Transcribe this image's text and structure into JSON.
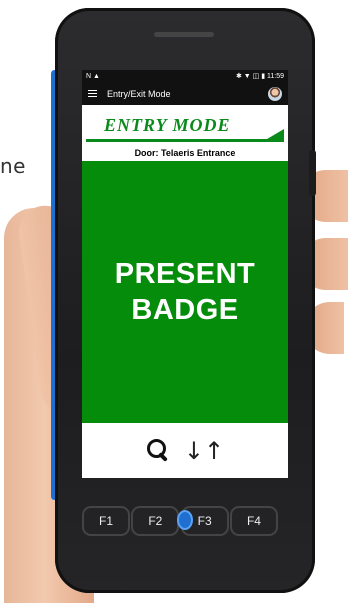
{
  "side_text": "ne",
  "status": {
    "left": "N ▲",
    "right": "✱ ▼ ◫ ▮ 11:59"
  },
  "appbar": {
    "title": "Entry/Exit Mode"
  },
  "banner": {
    "mode": "ENTRY MODE",
    "accent_color": "#0a8a1a"
  },
  "door": {
    "label": "Door: Telaeris Entrance"
  },
  "prompt": {
    "line1": "PRESENT",
    "line2": "BADGE",
    "background": "#058c0a"
  },
  "bottom": {
    "sort_glyph": "↓↑"
  },
  "function_keys": [
    "F1",
    "F2",
    "F3",
    "F4"
  ]
}
